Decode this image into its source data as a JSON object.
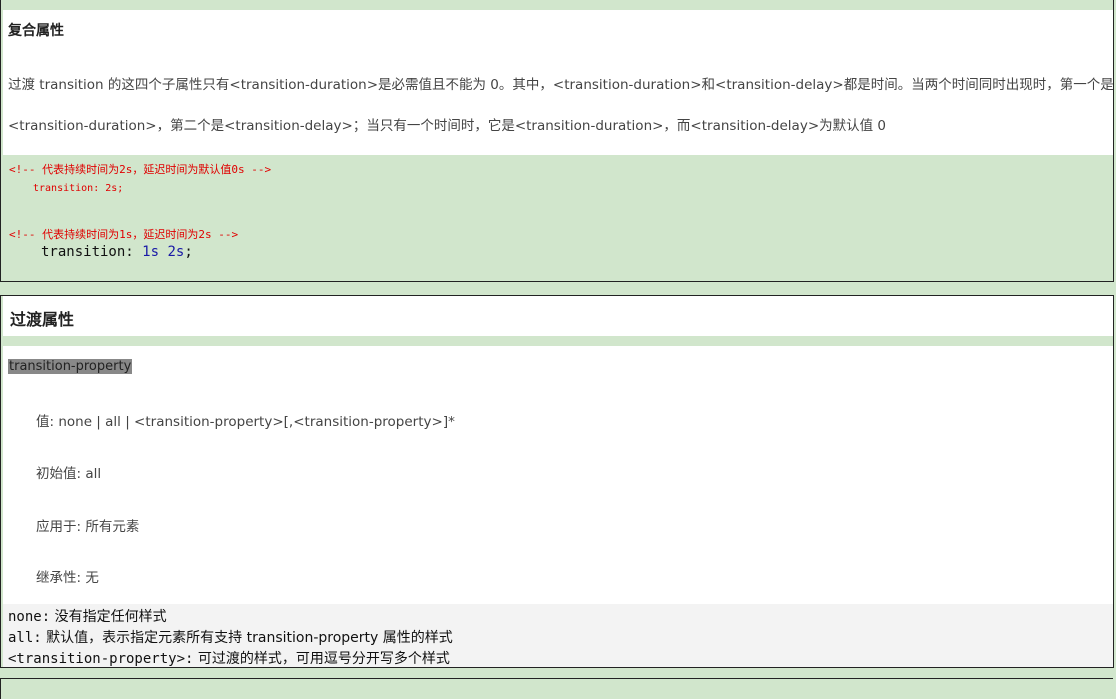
{
  "section1": {
    "title": "复合属性",
    "para_line1": "过渡 transition 的这四个子属性只有<transition-duration>是必需值且不能为 0。其中，<transition-duration>和<transition-delay>都是时间。当两个时间同时出现时，第一个是",
    "para_line2": "<transition-duration>，第二个是<transition-delay>；当只有一个时间时，它是<transition-duration>，而<transition-delay>为默认值 0",
    "code": {
      "comment1": "<!-- 代表持续时间为2s，延迟时间为默认值0s -->",
      "line1": "transition: 2s;",
      "comment2": "<!-- 代表持续时间为1s，延迟时间为2s -->",
      "line2_prop": "transition:",
      "line2_val": "1s 2s",
      "line2_end": ";"
    }
  },
  "section2": {
    "title": "过渡属性",
    "highlight": "transition-property",
    "rows": [
      "值: none | all | <transition-property>[,<transition-property>]*",
      "初始值: all",
      "应用于: 所有元素",
      "继承性: 无"
    ],
    "notes": [
      {
        "key": "none:",
        "text": " 没有指定任何样式"
      },
      {
        "key": "all:",
        "text": " 默认值，表示指定元素所有支持 transition-property 属性的样式"
      },
      {
        "key": "<transition-property>:",
        "text": " 可过渡的样式，可用逗号分开写多个样式"
      }
    ]
  }
}
